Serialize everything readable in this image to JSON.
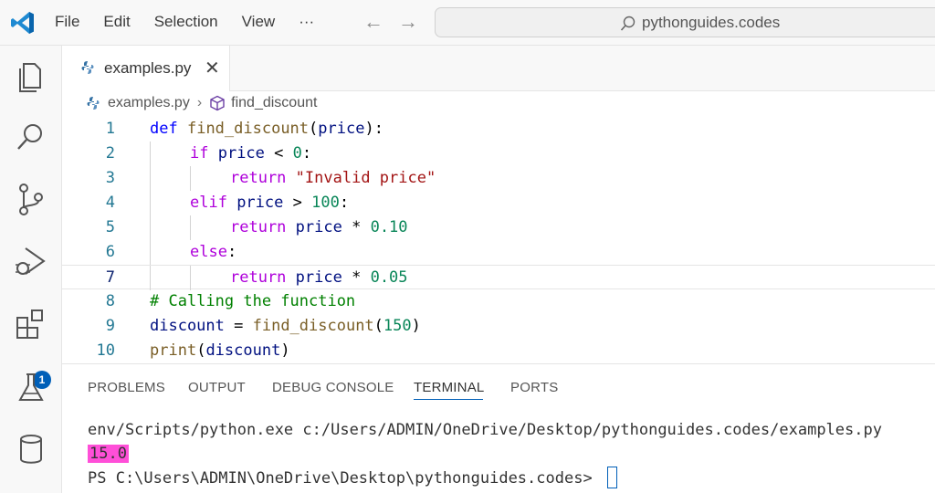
{
  "menu": [
    "File",
    "Edit",
    "Selection",
    "View",
    "···"
  ],
  "search": {
    "text": "pythonguides.codes"
  },
  "tab": {
    "label": "examples.py",
    "close": "✕"
  },
  "breadcrumb": {
    "file": "examples.py",
    "sep": "›",
    "symbol": "find_discount"
  },
  "activity": {
    "extensions_badge": "1"
  },
  "panel": {
    "tabs": [
      "PROBLEMS",
      "OUTPUT",
      "DEBUG CONSOLE",
      "TERMINAL",
      "PORTS"
    ],
    "active_tab": "TERMINAL"
  },
  "terminal": {
    "line1": "env/Scripts/python.exe c:/Users/ADMIN/OneDrive/Desktop/pythonguides.codes/examples.py",
    "output": "15.0",
    "prompt": "PS C:\\Users\\ADMIN\\OneDrive\\Desktop\\pythonguides.codes> "
  },
  "editor": {
    "current_line": 7,
    "lines": [
      {
        "n": "1",
        "indent": 0,
        "tokens": [
          [
            "def",
            "def"
          ],
          [
            " ",
            ""
          ],
          [
            "find_discount",
            "fn"
          ],
          [
            "(",
            "op"
          ],
          [
            "price",
            "var"
          ],
          [
            "):",
            "op"
          ]
        ]
      },
      {
        "n": "2",
        "indent": 1,
        "tokens": [
          [
            "if",
            "kw"
          ],
          [
            " price ",
            "var"
          ],
          [
            "<",
            "op"
          ],
          [
            " ",
            ""
          ],
          [
            "0",
            "num"
          ],
          [
            ":",
            "op"
          ]
        ]
      },
      {
        "n": "3",
        "indent": 2,
        "tokens": [
          [
            "return",
            "kw"
          ],
          [
            " ",
            ""
          ],
          [
            "\"Invalid price\"",
            "str"
          ]
        ]
      },
      {
        "n": "4",
        "indent": 1,
        "tokens": [
          [
            "elif",
            "kw"
          ],
          [
            " price ",
            "var"
          ],
          [
            ">",
            "op"
          ],
          [
            " ",
            ""
          ],
          [
            "100",
            "num"
          ],
          [
            ":",
            "op"
          ]
        ]
      },
      {
        "n": "5",
        "indent": 2,
        "tokens": [
          [
            "return",
            "kw"
          ],
          [
            " price ",
            "var"
          ],
          [
            "*",
            "op"
          ],
          [
            " ",
            ""
          ],
          [
            "0.10",
            "num"
          ]
        ]
      },
      {
        "n": "6",
        "indent": 1,
        "tokens": [
          [
            "else",
            "kw"
          ],
          [
            ":",
            "op"
          ]
        ]
      },
      {
        "n": "7",
        "indent": 2,
        "tokens": [
          [
            "return",
            "kw"
          ],
          [
            " price ",
            "var"
          ],
          [
            "*",
            "op"
          ],
          [
            " ",
            ""
          ],
          [
            "0.05",
            "num"
          ]
        ]
      },
      {
        "n": "8",
        "indent": 0,
        "tokens": [
          [
            "# Calling the function",
            "cmt"
          ]
        ]
      },
      {
        "n": "9",
        "indent": 0,
        "tokens": [
          [
            "discount",
            "var"
          ],
          [
            " = ",
            "op"
          ],
          [
            "find_discount",
            "fn"
          ],
          [
            "(",
            "op"
          ],
          [
            "150",
            "num"
          ],
          [
            ")",
            "op"
          ]
        ]
      },
      {
        "n": "10",
        "indent": 0,
        "tokens": [
          [
            "print",
            "fn"
          ],
          [
            "(",
            "op"
          ],
          [
            "discount",
            "var"
          ],
          [
            ")",
            "op"
          ]
        ]
      }
    ]
  },
  "colors": {
    "accent": "#005fb8",
    "highlight": "#ff4fd8"
  }
}
